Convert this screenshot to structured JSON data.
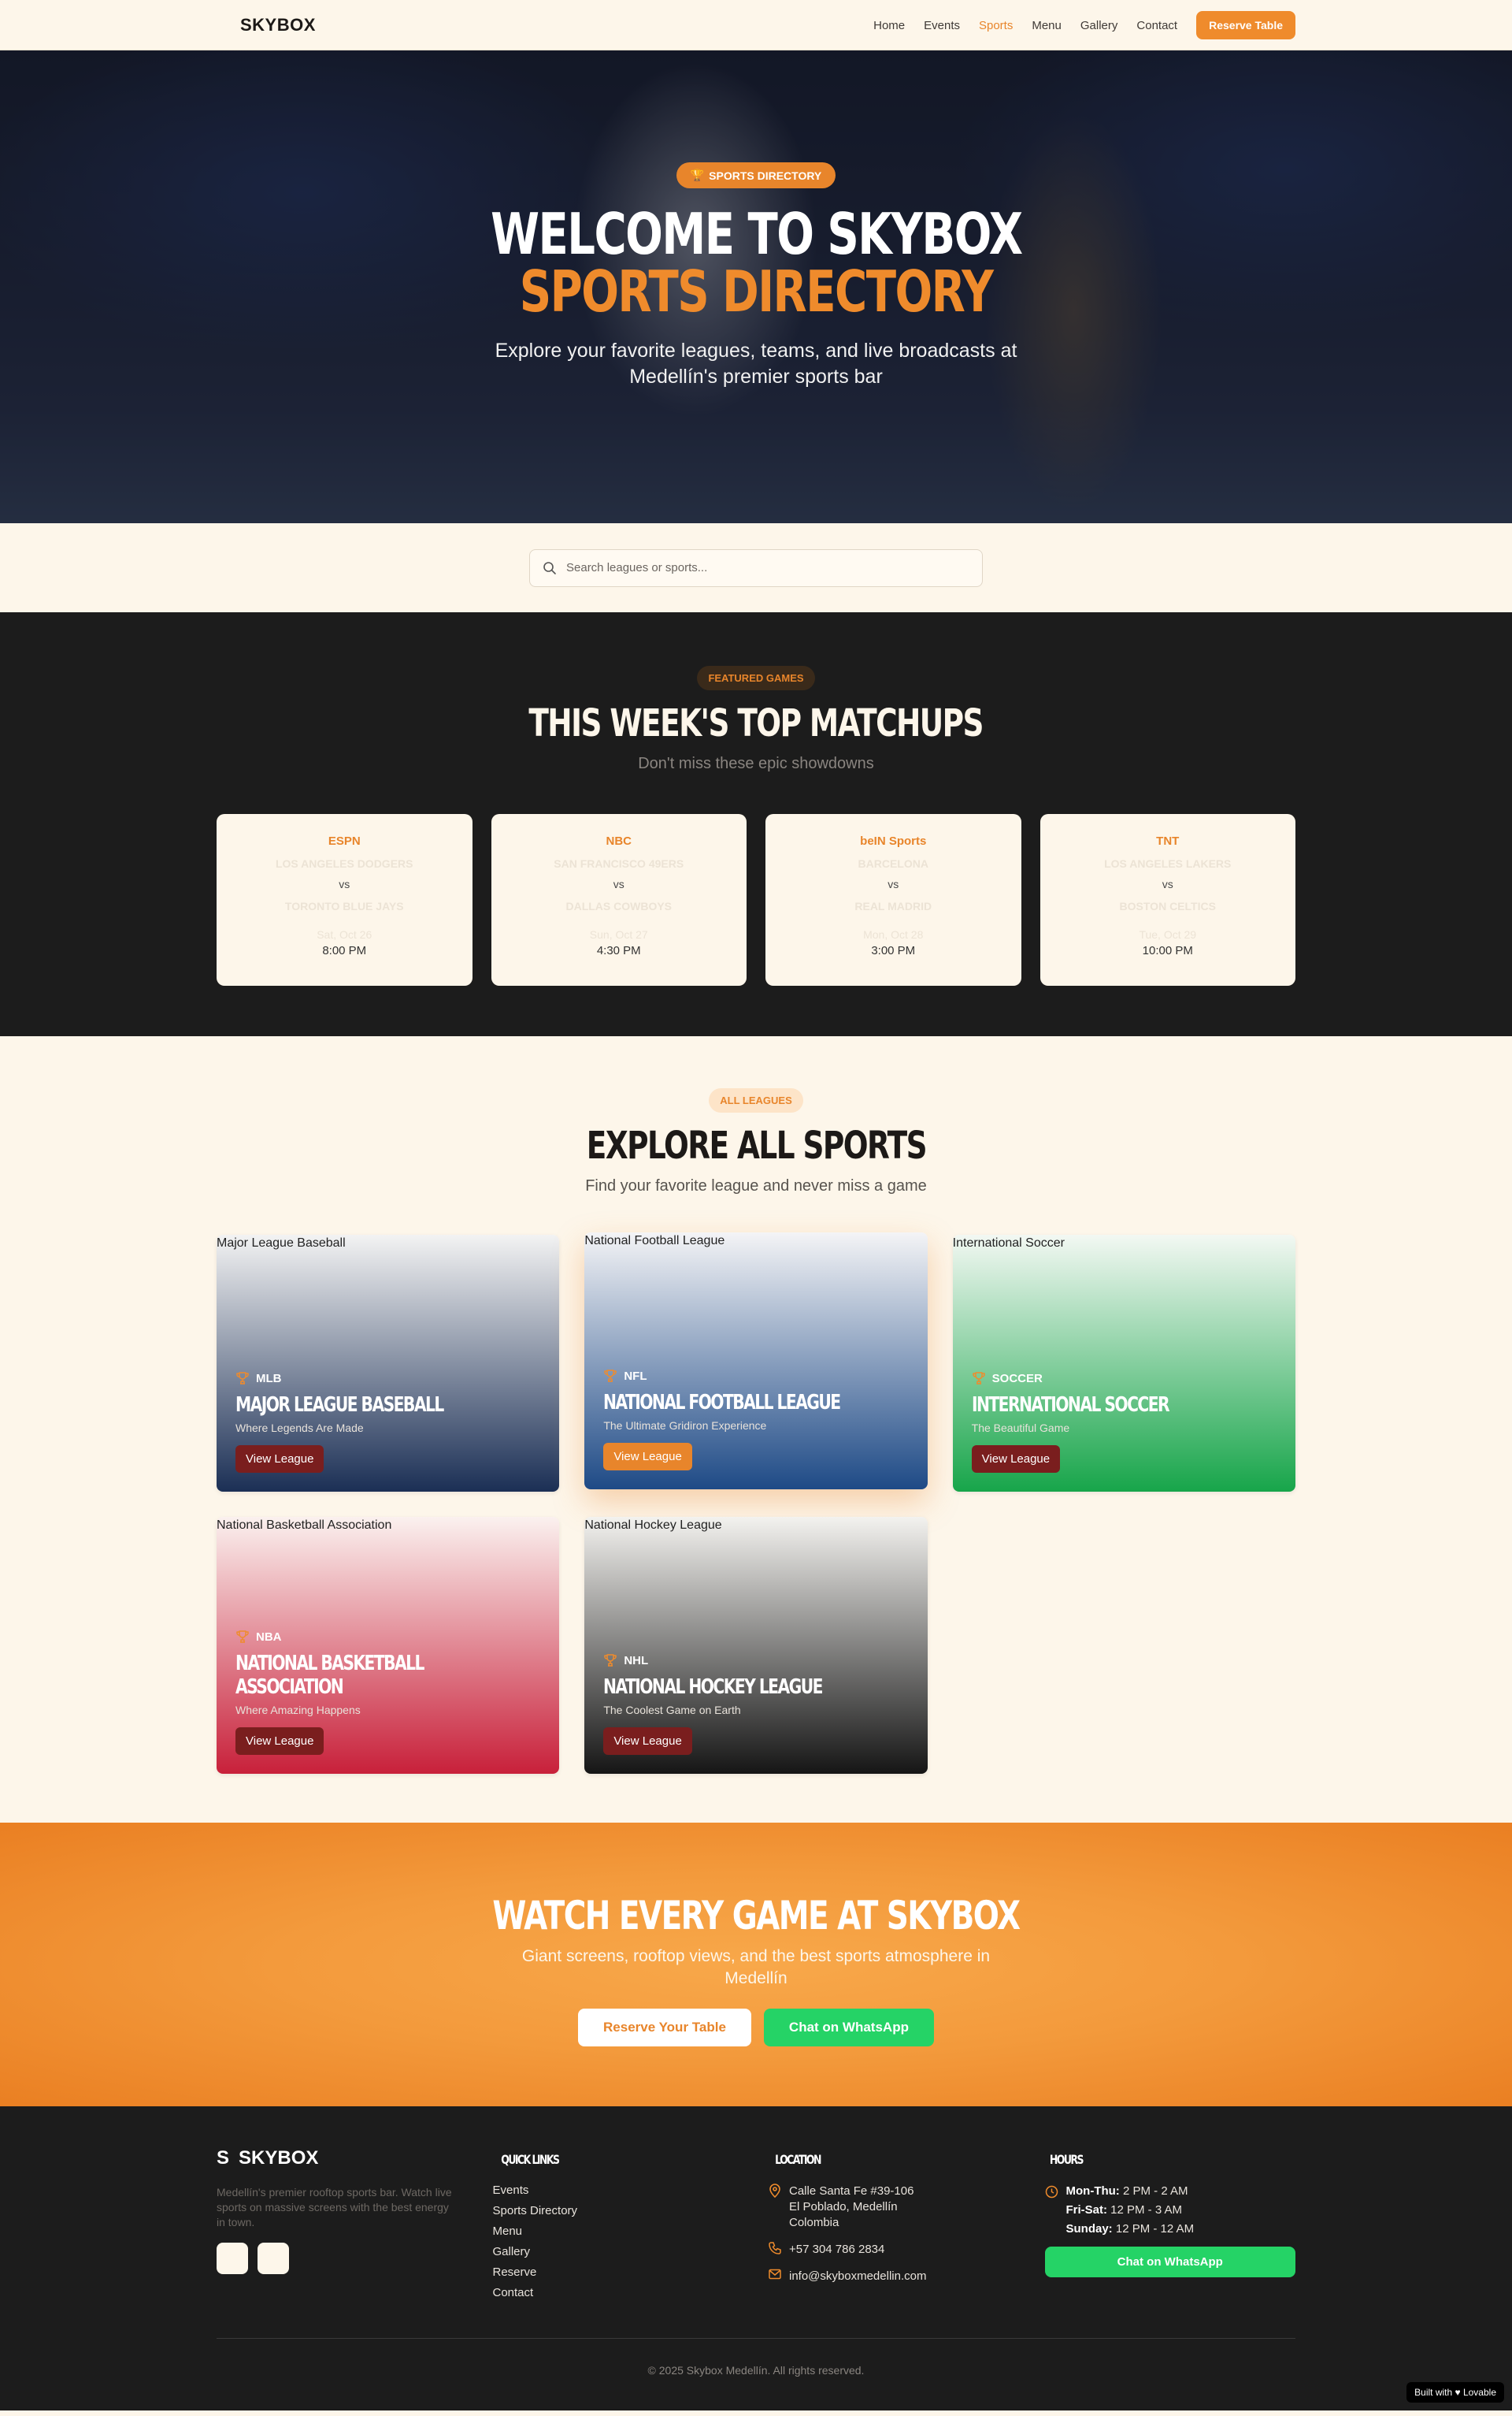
{
  "nav": {
    "brand": "SKYBOX",
    "links": [
      "Home",
      "Events",
      "Sports",
      "Menu",
      "Gallery",
      "Contact"
    ],
    "active": "Sports",
    "reserve_label": "Reserve Table"
  },
  "hero": {
    "badge": "SPORTS DIRECTORY",
    "title_line1": "WELCOME TO SKYBOX",
    "title_line2": "SPORTS DIRECTORY",
    "subtitle_line1": "Explore your favorite leagues, teams, and live broadcasts at",
    "subtitle_line2": "Medellín's premier sports bar"
  },
  "search": {
    "placeholder": "Search leagues or sports..."
  },
  "featured": {
    "pill": "FEATURED GAMES",
    "title": "THIS WEEK'S TOP MATCHUPS",
    "subtitle": "Don't miss these epic showdowns",
    "games": [
      {
        "network": "ESPN",
        "team1": "LOS ANGELES DODGERS",
        "vs": "vs",
        "team2": "TORONTO BLUE JAYS",
        "date": "Sat, Oct 26",
        "time": "8:00 PM"
      },
      {
        "network": "NBC",
        "team1": "SAN FRANCISCO 49ERS",
        "vs": "vs",
        "team2": "DALLAS COWBOYS",
        "date": "Sun, Oct 27",
        "time": "4:30 PM"
      },
      {
        "network": "beIN Sports",
        "team1": "BARCELONA",
        "vs": "vs",
        "team2": "REAL MADRID",
        "date": "Mon, Oct 28",
        "time": "3:00 PM"
      },
      {
        "network": "TNT",
        "team1": "LOS ANGELES LAKERS",
        "vs": "vs",
        "team2": "BOSTON CELTICS",
        "date": "Tue, Oct 29",
        "time": "10:00 PM"
      }
    ]
  },
  "leagues": {
    "pill": "ALL LEAGUES",
    "title": "EXPLORE ALL SPORTS",
    "subtitle": "Find your favorite league and never miss a game",
    "button_label": "View League",
    "items": [
      {
        "alt": "Major League Baseball",
        "tag": "MLB",
        "name": "MAJOR LEAGUE BASEBALL",
        "tagline": "Where Legends Are Made",
        "top": "#f3f3f3",
        "bottom": "#1b2f55"
      },
      {
        "alt": "National Football League",
        "tag": "NFL",
        "name": "NATIONAL FOOTBALL LEAGUE",
        "tagline": "The Ultimate Gridiron Experience",
        "top": "#f4f4f6",
        "bottom": "#1e4a86"
      },
      {
        "alt": "International Soccer",
        "tag": "SOCCER",
        "name": "INTERNATIONAL SOCCER",
        "tagline": "The Beautiful Game",
        "top": "#f3f8f3",
        "bottom": "#17a54a"
      },
      {
        "alt": "National Basketball Association",
        "tag": "NBA",
        "name": "NATIONAL BASKETBALL ASSOCIATION",
        "tagline": "Where Amazing Happens",
        "top": "#fbf1ef",
        "bottom": "#c8203a"
      },
      {
        "alt": "National Hockey League",
        "tag": "NHL",
        "name": "NATIONAL HOCKEY LEAGUE",
        "tagline": "The Coolest Game on Earth",
        "top": "#f3f2ef",
        "bottom": "#151515"
      }
    ]
  },
  "cta": {
    "title": "WATCH EVERY GAME AT SKYBOX",
    "subtitle_line1": "Giant screens, rooftop views, and the best sports atmosphere in",
    "subtitle_line2": "Medellín",
    "reserve_label": "Reserve Your Table",
    "whatsapp_label": "Chat on WhatsApp"
  },
  "footer": {
    "brand_initial": "S",
    "brand": "SKYBOX",
    "description": "Medellín's premier rooftop sports bar. Watch live sports on massive screens with the best energy in town.",
    "quick_links_title": "QUICK LINKS",
    "quick_links": [
      "Events",
      "Sports Directory",
      "Menu",
      "Gallery",
      "Reserve",
      "Contact"
    ],
    "location_title": "LOCATION",
    "address_line1": "Calle Santa Fe #39-106",
    "address_line2": "El Poblado, Medellín",
    "address_line3": "Colombia",
    "phone": "+57 304 786 2834",
    "email": "info@skyboxmedellin.com",
    "hours_title": "HOURS",
    "hours": [
      {
        "days": "Mon-Thu:",
        "time": " 2 PM - 2 AM"
      },
      {
        "days": "Fri-Sat:",
        "time": " 12 PM - 3 AM"
      },
      {
        "days": "Sunday:",
        "time": " 12 PM - 12 AM"
      }
    ],
    "whatsapp_label": "Chat on WhatsApp",
    "copyright": "© 2025 Skybox Medellín. All rights reserved.",
    "built_with": "Built with ♥ Lovable"
  },
  "colors": {
    "accent": "#ef8b2c",
    "dark": "#1c1c1c",
    "cream": "#fdf6ea",
    "whatsapp": "#25d366"
  }
}
